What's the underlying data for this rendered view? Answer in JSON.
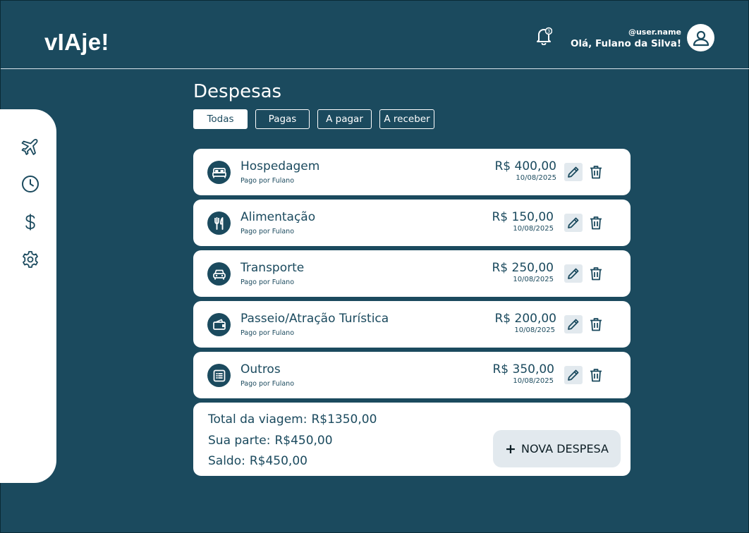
{
  "app": {
    "logo": "vIAje!"
  },
  "header": {
    "notification_count": "3",
    "user_handle": "@user.name",
    "greeting": "Olá, Fulano da Silva!"
  },
  "sidebar": {
    "items": [
      {
        "icon": "airplane-icon"
      },
      {
        "icon": "clock-icon"
      },
      {
        "icon": "dollar-icon"
      },
      {
        "icon": "gear-icon"
      }
    ]
  },
  "page": {
    "title": "Despesas",
    "filters": [
      "Todas",
      "Pagas",
      "A pagar",
      "A receber"
    ],
    "active_filter": "Todas"
  },
  "expenses": [
    {
      "category": "Hospedagem",
      "payer": "Pago por Fulano",
      "amount": "R$ 400,00",
      "date": "10/08/2025",
      "icon": "bed-icon"
    },
    {
      "category": "Alimentação",
      "payer": "Pago por Fulano",
      "amount": "R$ 150,00",
      "date": "10/08/2025",
      "icon": "fork-knife-icon"
    },
    {
      "category": "Transporte",
      "payer": "Pago por Fulano",
      "amount": "R$ 250,00",
      "date": "10/08/2025",
      "icon": "car-icon"
    },
    {
      "category": "Passeio/Atração Turística",
      "payer": "Pago por Fulano",
      "amount": "R$ 200,00",
      "date": "10/08/2025",
      "icon": "ticket-icon"
    },
    {
      "category": "Outros",
      "payer": "Pago por Fulano",
      "amount": "R$ 350,00",
      "date": "10/08/2025",
      "icon": "list-icon"
    }
  ],
  "summary": {
    "total_label": "Total da viagem:",
    "total_value": "R$1350,00",
    "share_label": "Sua parte:",
    "share_value": "R$450,00",
    "balance_label": "Saldo:",
    "balance_value": "R$450,00",
    "new_button_label": "NOVA DESPESA"
  },
  "colors": {
    "primary": "#1b4a5e",
    "surface": "#ffffff",
    "button_bg": "#e2e9ee"
  }
}
